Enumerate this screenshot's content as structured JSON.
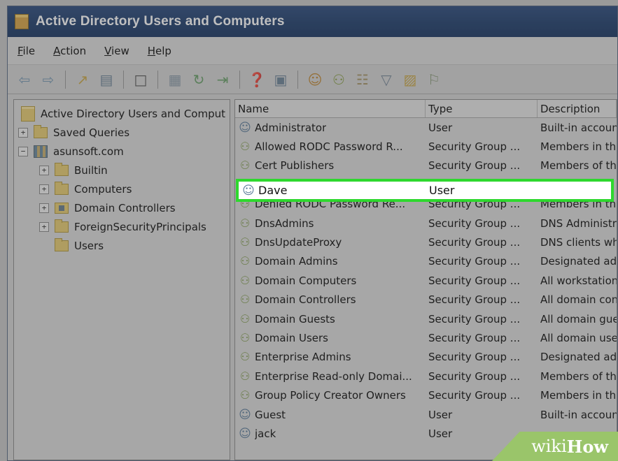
{
  "window": {
    "title": "Active Directory Users and Computers"
  },
  "menu": [
    {
      "key": "F",
      "rest": "ile"
    },
    {
      "key": "A",
      "rest": "ction"
    },
    {
      "key": "V",
      "rest": "iew"
    },
    {
      "key": "H",
      "rest": "elp"
    }
  ],
  "toolbar": {
    "icons": [
      "back-arrow-icon",
      "forward-arrow-icon",
      "up-folder-icon",
      "show-console-tree-icon",
      "clipboard-icon",
      "properties-icon",
      "refresh-icon",
      "export-list-icon",
      "help-icon",
      "show-action-pane-icon",
      "new-user-icon",
      "new-group-icon",
      "new-ou-icon",
      "filter-icon",
      "add-to-group-icon",
      "find-users-icon"
    ]
  },
  "tree": {
    "root": "Active Directory Users and Comput",
    "items": [
      {
        "label": "Saved Queries",
        "level": 1,
        "expander": "+"
      },
      {
        "label": "asunsoft.com",
        "level": 1,
        "expander": "−"
      },
      {
        "label": "Builtin",
        "level": 2,
        "expander": "+"
      },
      {
        "label": "Computers",
        "level": 2,
        "expander": "+"
      },
      {
        "label": "Domain Controllers",
        "level": 2,
        "expander": "+"
      },
      {
        "label": "ForeignSecurityPrincipals",
        "level": 2,
        "expander": "+"
      },
      {
        "label": "Users",
        "level": 2,
        "expander": ""
      }
    ]
  },
  "list": {
    "columns": {
      "name": "Name",
      "type": "Type",
      "description": "Description"
    },
    "rows": [
      {
        "name": "Administrator",
        "type": "User",
        "description": "Built-in account",
        "kind": "user"
      },
      {
        "name": "Allowed RODC Password R...",
        "type": "Security Group ...",
        "description": "Members in this",
        "kind": "group"
      },
      {
        "name": "Cert Publishers",
        "type": "Security Group ...",
        "description": "Members of this",
        "kind": "group"
      },
      {
        "name": "Dave",
        "type": "User",
        "description": "",
        "kind": "user"
      },
      {
        "name": "Denied RODC Password Re...",
        "type": "Security Group ...",
        "description": "Members in this",
        "kind": "group"
      },
      {
        "name": "DnsAdmins",
        "type": "Security Group ...",
        "description": "DNS Administra",
        "kind": "group"
      },
      {
        "name": "DnsUpdateProxy",
        "type": "Security Group ...",
        "description": "DNS clients who",
        "kind": "group"
      },
      {
        "name": "Domain Admins",
        "type": "Security Group ...",
        "description": "Designated adm",
        "kind": "group"
      },
      {
        "name": "Domain Computers",
        "type": "Security Group ...",
        "description": "All workstations",
        "kind": "group"
      },
      {
        "name": "Domain Controllers",
        "type": "Security Group ...",
        "description": "All domain cont",
        "kind": "group"
      },
      {
        "name": "Domain Guests",
        "type": "Security Group ...",
        "description": "All domain gues",
        "kind": "group"
      },
      {
        "name": "Domain Users",
        "type": "Security Group ...",
        "description": "All domain user",
        "kind": "group"
      },
      {
        "name": "Enterprise Admins",
        "type": "Security Group ...",
        "description": "Designated adm",
        "kind": "group"
      },
      {
        "name": "Enterprise Read-only Domai...",
        "type": "Security Group ...",
        "description": "Members of this",
        "kind": "group"
      },
      {
        "name": "Group Policy Creator Owners",
        "type": "Security Group ...",
        "description": "Members in this",
        "kind": "group"
      },
      {
        "name": "Guest",
        "type": "User",
        "description": "Built-in account",
        "kind": "user"
      },
      {
        "name": "jack",
        "type": "User",
        "description": "",
        "kind": "user"
      }
    ],
    "highlighted": {
      "name": "Dave",
      "type": "User"
    }
  },
  "watermark": {
    "wiki": "wiki",
    "how": "How"
  },
  "colors": {
    "highlight_border": "#2ed82e",
    "titlebar": "#23416f"
  }
}
